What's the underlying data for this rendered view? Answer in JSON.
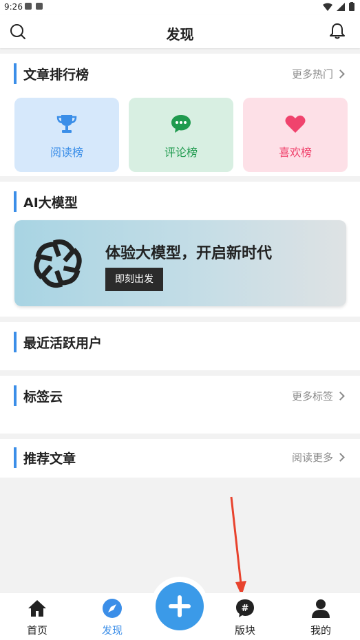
{
  "status_bar": {
    "time": "9:26"
  },
  "header": {
    "title": "发现"
  },
  "sections": {
    "ranking": {
      "title": "文章排行榜",
      "more": "更多热门",
      "cards": [
        {
          "label": "阅读榜",
          "icon": "trophy-icon",
          "bg": "#d6e8fb",
          "color": "#3b8ee8"
        },
        {
          "label": "评论榜",
          "icon": "chat-bubble-icon",
          "bg": "#d8efe2",
          "color": "#1f9a4e"
        },
        {
          "label": "喜欢榜",
          "icon": "heart-icon",
          "bg": "#fde0e7",
          "color": "#f0436d"
        }
      ]
    },
    "ai": {
      "title": "AI大模型",
      "banner_text": "体验大模型，开启新时代",
      "button_label": "即刻出发"
    },
    "active_users": {
      "title": "最近活跃用户"
    },
    "tag_cloud": {
      "title": "标签云",
      "more": "更多标签"
    },
    "recommended": {
      "title": "推荐文章",
      "more": "阅读更多"
    }
  },
  "tabbar": {
    "items": [
      {
        "label": "首页",
        "icon": "home-icon",
        "active": false
      },
      {
        "label": "发现",
        "icon": "compass-icon",
        "active": true
      },
      {
        "label": "版块",
        "icon": "hashtag-icon",
        "active": false
      },
      {
        "label": "我的",
        "icon": "user-icon",
        "active": false
      }
    ],
    "fab_icon": "plus-icon"
  },
  "colors": {
    "accent": "#3b8ee8",
    "annotation_arrow": "#e8432e"
  }
}
